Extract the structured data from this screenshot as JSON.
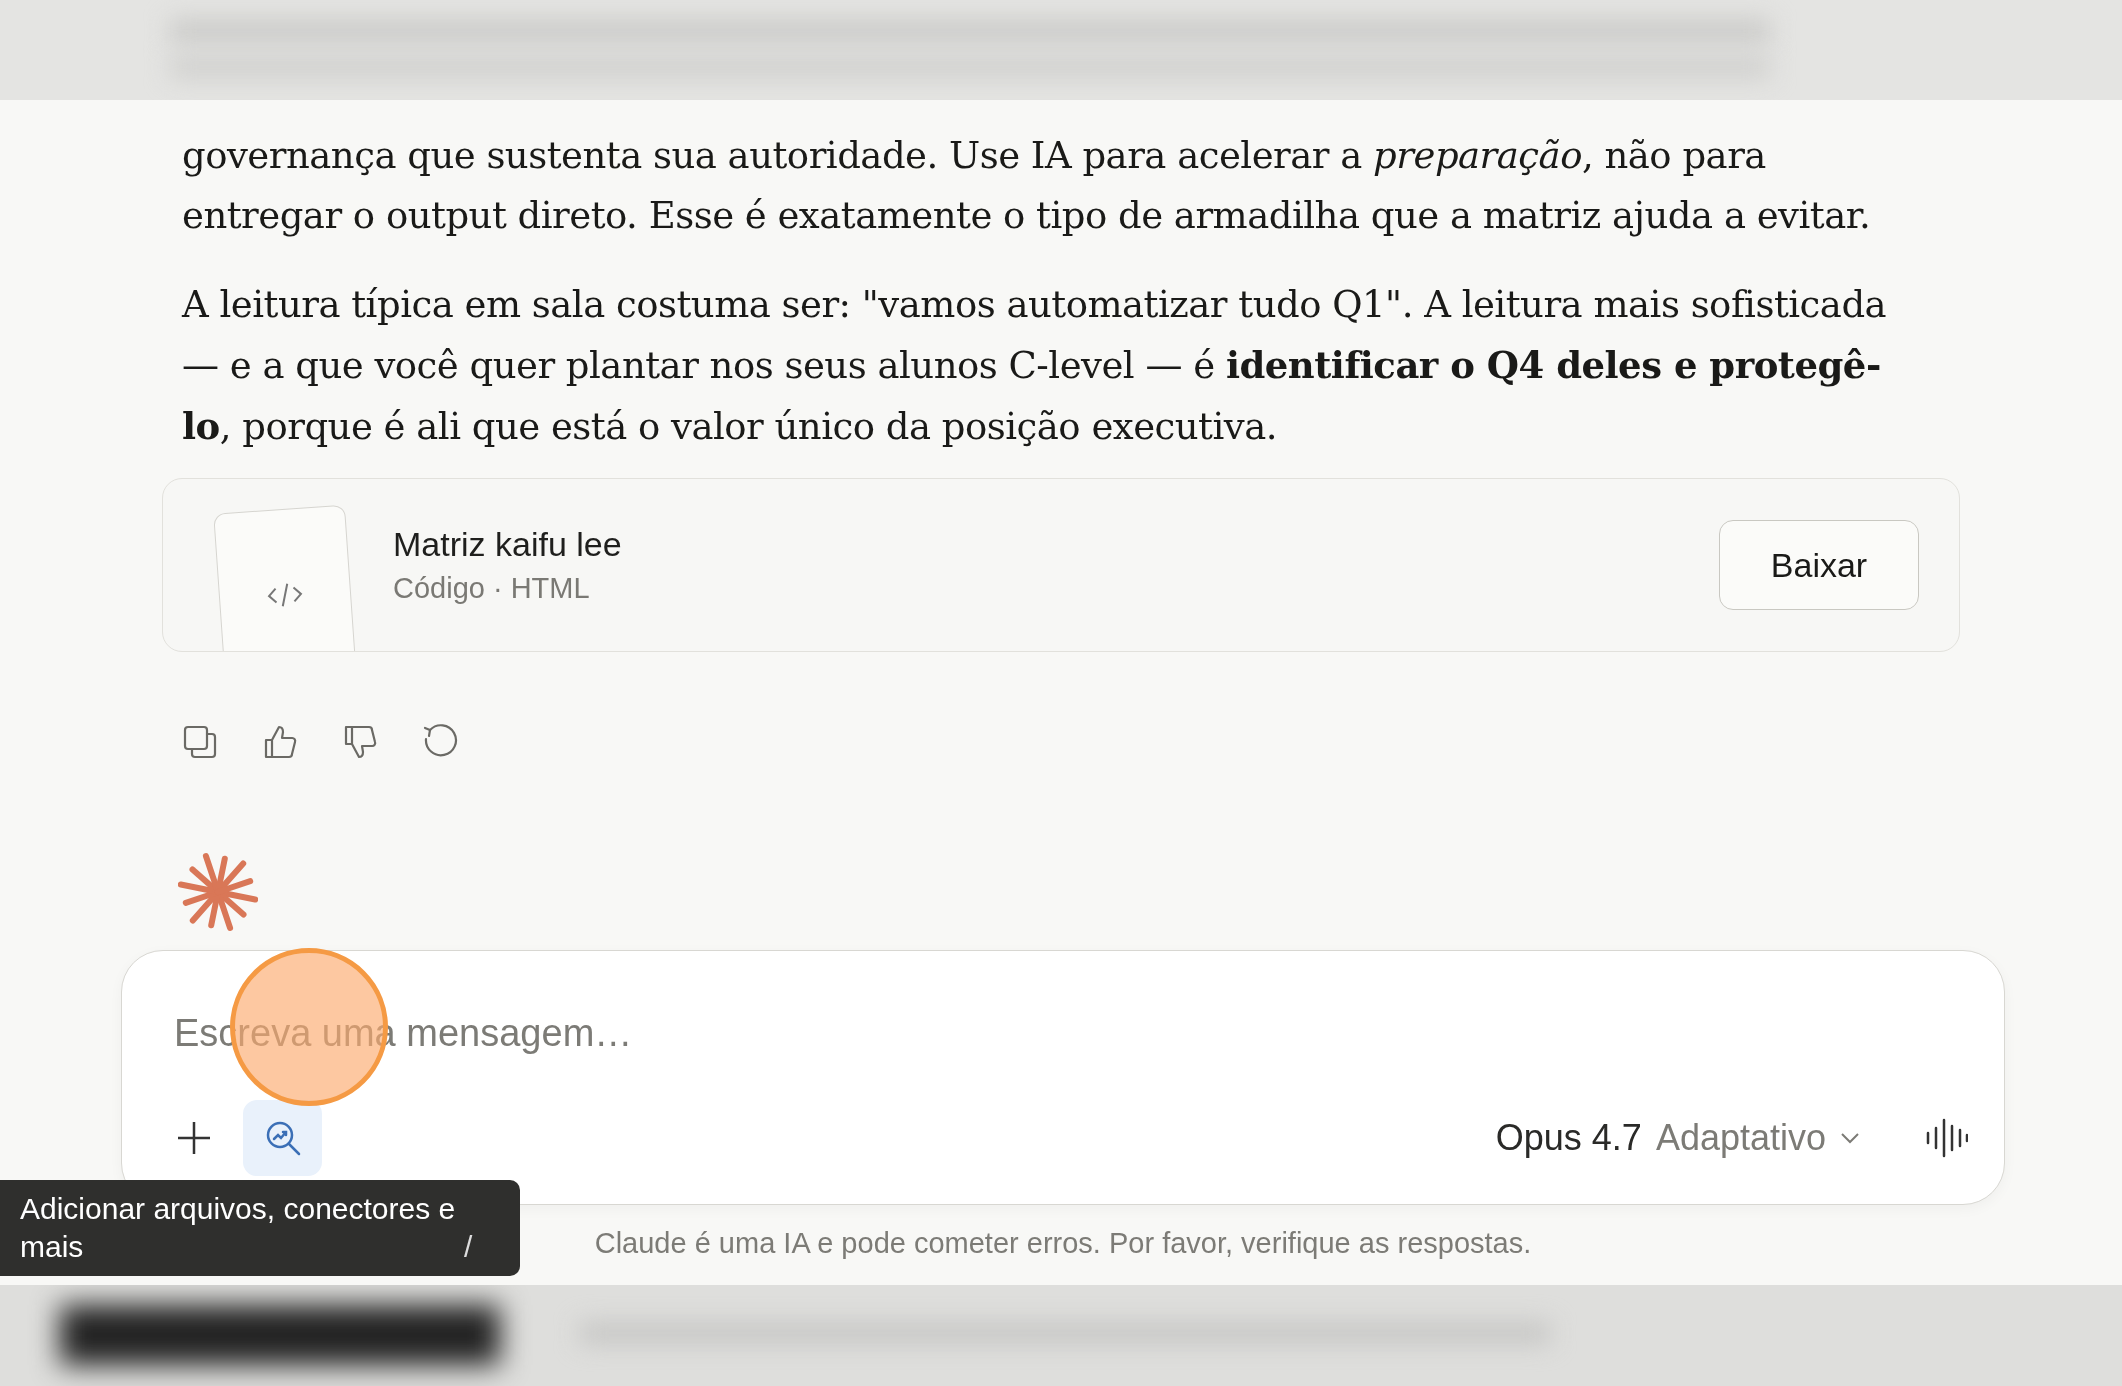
{
  "message": {
    "paragraphs": [
      "governança que sustenta sua autoridade. Use IA para acelerar a *preparação*, não para entregar o output direto. Esse é exatamente o tipo de armadilha que a matriz ajuda a evitar.",
      "A leitura típica em sala costuma ser: \"vamos automatizar tudo Q1\". A leitura mais sofisticada — e a que você quer plantar nos seus alunos C-level — é **identificar o Q4 deles e protegê-lo**, porque é ali que está o valor único da posição executiva."
    ]
  },
  "artifact": {
    "title": "Matriz kaifu lee",
    "subtitle": "Código · HTML",
    "button": "Baixar"
  },
  "composer": {
    "placeholder": "Escreva uma mensagem…",
    "model": "Opus 4.7",
    "mode": "Adaptativo"
  },
  "tooltip": {
    "text": "Adicionar arquivos, conectores e mais",
    "shortcut": "/"
  },
  "disclaimer": "Claude é uma IA e pode cometer erros. Por favor, verifique as respostas."
}
